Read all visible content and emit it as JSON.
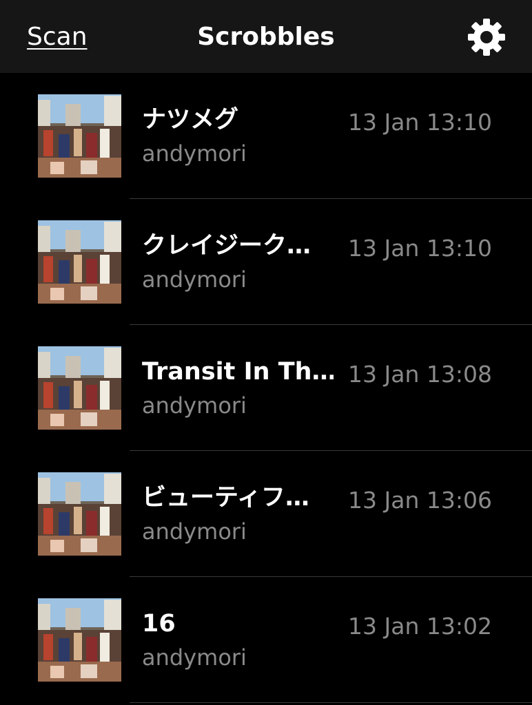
{
  "nav": {
    "scan_label": "Scan",
    "title": "Scrobbles",
    "settings_icon": "gear-icon"
  },
  "colors": {
    "background": "#000000",
    "navbar": "#161616",
    "primary_text": "#ffffff",
    "secondary_text": "#8a8a8a",
    "separator": "#3a3a3a"
  },
  "scrobbles": [
    {
      "track": "ナツメグ",
      "artist": "andymori",
      "time": "13 Jan 13:10"
    },
    {
      "track": "クレイジーク…",
      "artist": "andymori",
      "time": "13 Jan 13:10"
    },
    {
      "track": "Transit In Th…",
      "artist": "andymori",
      "time": "13 Jan 13:08"
    },
    {
      "track": "ビューティフ…",
      "artist": "andymori",
      "time": "13 Jan 13:06"
    },
    {
      "track": "16",
      "artist": "andymori",
      "time": "13 Jan 13:02"
    }
  ]
}
